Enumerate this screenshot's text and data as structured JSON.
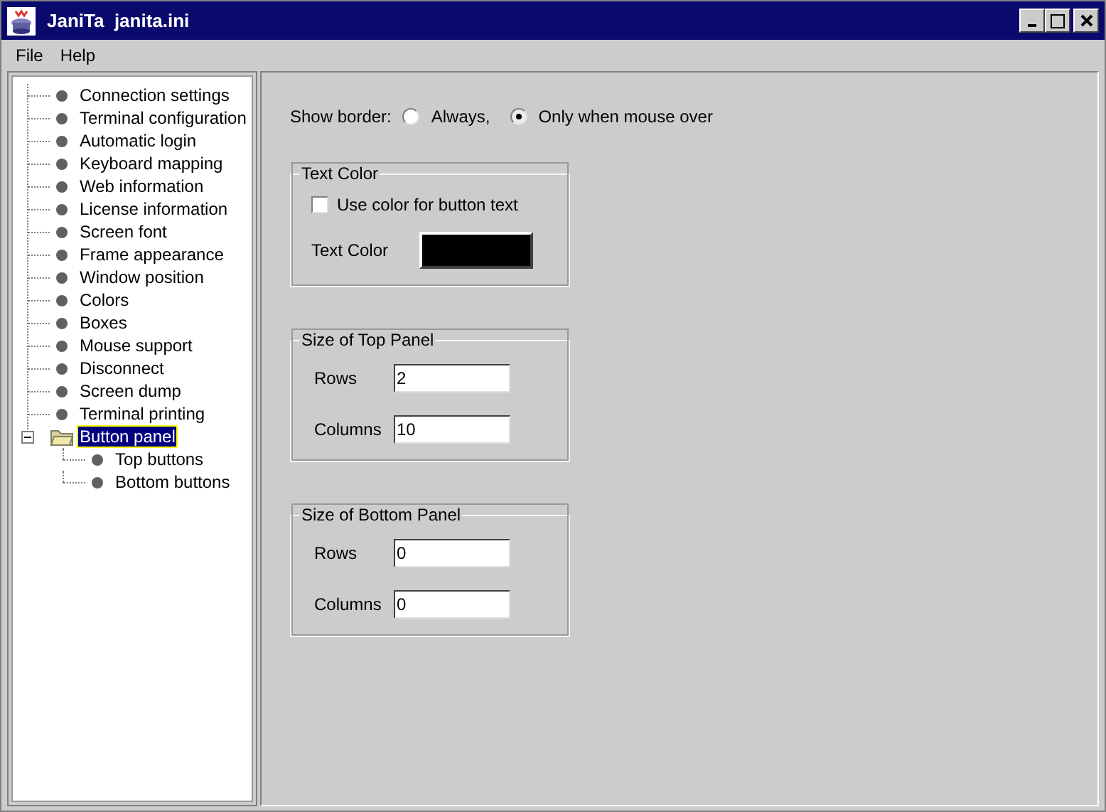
{
  "window": {
    "title": "JaniTa  janita.ini"
  },
  "menu": [
    "File",
    "Help"
  ],
  "tree": [
    {
      "label": "Connection settings",
      "selected": false
    },
    {
      "label": "Terminal configuration",
      "selected": false
    },
    {
      "label": "Automatic login",
      "selected": false
    },
    {
      "label": "Keyboard mapping",
      "selected": false
    },
    {
      "label": "Web information",
      "selected": false
    },
    {
      "label": "License information",
      "selected": false
    },
    {
      "label": "Screen font",
      "selected": false
    },
    {
      "label": "Frame appearance",
      "selected": false
    },
    {
      "label": "Window position",
      "selected": false
    },
    {
      "label": "Colors",
      "selected": false
    },
    {
      "label": "Boxes",
      "selected": false
    },
    {
      "label": "Mouse support",
      "selected": false
    },
    {
      "label": "Disconnect",
      "selected": false
    },
    {
      "label": "Screen dump",
      "selected": false
    },
    {
      "label": "Terminal printing",
      "selected": false
    },
    {
      "label": "Button panel",
      "selected": true,
      "expanded": true,
      "children": [
        {
          "label": "Top buttons",
          "selected": false
        },
        {
          "label": "Bottom buttons",
          "selected": false
        }
      ]
    }
  ],
  "show_border": {
    "label": "Show border:",
    "options": [
      {
        "label": "Always,",
        "selected": false
      },
      {
        "label": "Only when mouse over",
        "selected": true
      }
    ]
  },
  "text_color_group": {
    "title": "Text Color",
    "checkbox": {
      "label": "Use color for button text",
      "checked": false
    },
    "color_label": "Text Color",
    "color": "#000000"
  },
  "panels": [
    {
      "title": "Size of Top Panel",
      "fields": [
        {
          "label": "Rows",
          "value": "2"
        },
        {
          "label": "Columns",
          "value": "10"
        }
      ]
    },
    {
      "title": "Size of Bottom Panel",
      "fields": [
        {
          "label": "Rows",
          "value": "0"
        },
        {
          "label": "Columns",
          "value": "0"
        }
      ]
    }
  ]
}
